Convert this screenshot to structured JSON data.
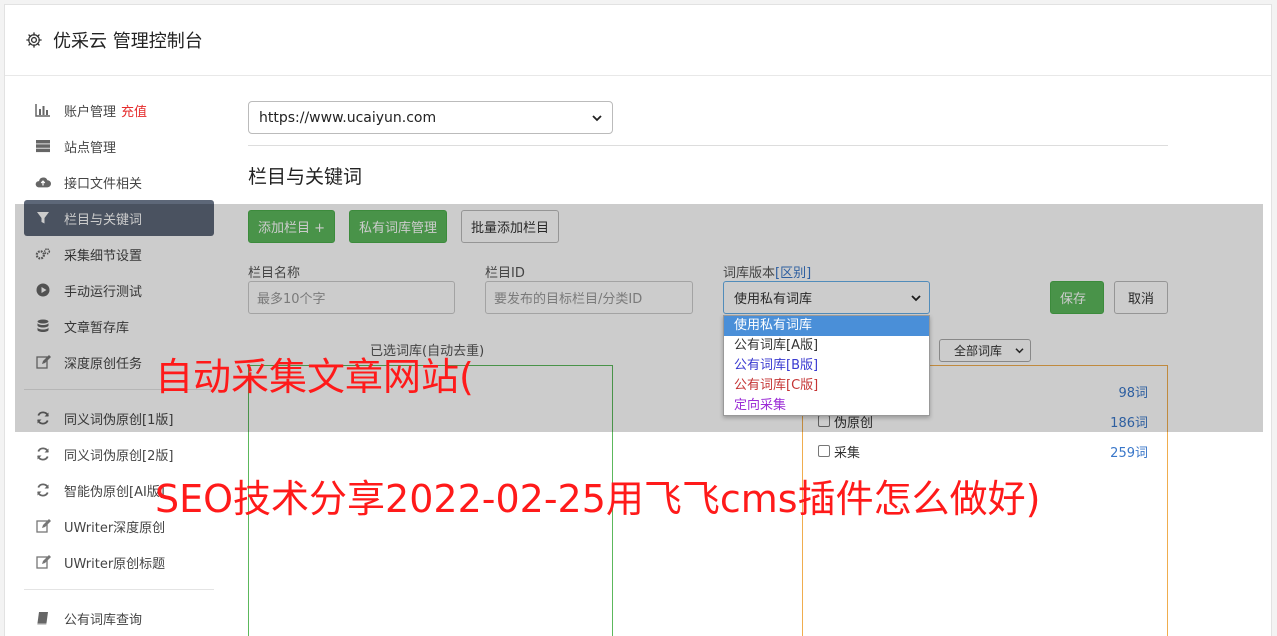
{
  "header": {
    "title": "优采云 管理控制台"
  },
  "sidebar": {
    "items": [
      {
        "label": "账户管理",
        "badge": "充值",
        "icon": "bar-chart-icon"
      },
      {
        "label": "站点管理",
        "icon": "server-icon"
      },
      {
        "label": "接口文件相关",
        "icon": "cloud-upload-icon"
      },
      {
        "label": "栏目与关键词",
        "icon": "filter-icon",
        "active": true
      },
      {
        "label": "采集细节设置",
        "icon": "gears-icon"
      },
      {
        "label": "手动运行测试",
        "icon": "play-circle-icon"
      },
      {
        "label": "文章暂存库",
        "icon": "database-icon"
      },
      {
        "label": "深度原创任务",
        "icon": "edit-icon"
      },
      {
        "label": "同义词伪原创[1版]",
        "icon": "refresh-icon"
      },
      {
        "label": "同义词伪原创[2版]",
        "icon": "refresh-icon"
      },
      {
        "label": "智能伪原创[AI版]",
        "icon": "refresh-icon"
      },
      {
        "label": "UWriter深度原创",
        "icon": "edit-icon"
      },
      {
        "label": "UWriter原创标题",
        "icon": "edit-icon"
      },
      {
        "label": "公有词库查询",
        "icon": "book-icon"
      }
    ]
  },
  "main": {
    "site_select": "https://www.ucaiyun.com",
    "section_title": "栏目与关键词",
    "buttons": {
      "add_column": "添加栏目 +",
      "private_lib": "私有词库管理",
      "batch_add": "批量添加栏目"
    },
    "fields": {
      "column_name_label": "栏目名称",
      "column_name_placeholder": "最多10个字",
      "column_id_label": "栏目ID",
      "column_id_placeholder": "要发布的目标栏目/分类ID",
      "lib_version_label": "词库版本",
      "lib_version_link": "[区别]",
      "lib_version_value": "使用私有词库"
    },
    "save": "保存",
    "cancel": "取消",
    "left_box_head": "已选词库(自动去重)",
    "all_lib": "全部词库",
    "lib_rows": [
      {
        "label": "",
        "count": "98词"
      },
      {
        "label": "伪原创",
        "count": "186词"
      },
      {
        "label": "采集",
        "count": "259词"
      }
    ],
    "dropdown": [
      "使用私有词库",
      "公有词库[A版]",
      "公有词库[B版]",
      "公有词库[C版]",
      "定向采集"
    ]
  },
  "watermark": {
    "line1": "自动采集文章网站(",
    "line2": "SEO技术分享2022-02-25用飞飞cms插件怎么做好)"
  },
  "colors": {
    "accent_green": "#5cb85c",
    "active_nav": "#5d6778",
    "watermark": "#ff1a1a",
    "recharge": "#e52b2b"
  }
}
